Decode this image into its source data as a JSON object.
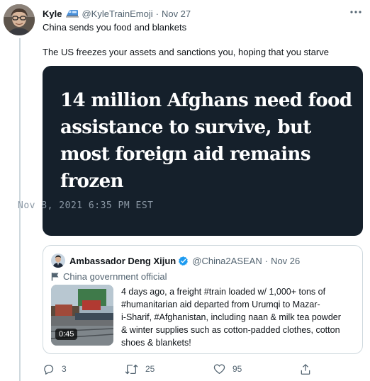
{
  "tweet": {
    "author_name": "Kyle",
    "author_emoji": "train-emoji",
    "handle": "@KyleTrainEmoji",
    "separator": "·",
    "date": "Nov 27",
    "text_lines": [
      "China sends you food and blankets",
      "The US freezes your assets and sanctions you, hoping that you starve"
    ],
    "media_card": {
      "headline_lines": [
        "14 million Afghans need food",
        "assistance to survive, but",
        "most foreign aid remains",
        "frozen"
      ],
      "dateline": "Nov 8, 2021 6:35 PM EST",
      "background": "#15202b"
    }
  },
  "quoted_tweet": {
    "author_name": "Ambassador Deng Xijun",
    "handle": "@China2ASEAN",
    "separator": "·",
    "date": "Nov 26",
    "label": "China government official",
    "thumbnail_duration": "0:45",
    "text_lines": [
      "4 days ago, a freight #train loaded w/ 1,000+ tons of",
      "#humanitarian aid departed from Urumqi to Mazar-",
      "i-Sharif, #Afghanistan, including naan & milk tea powder",
      "& winter supplies such as cotton-padded clothes, cotton",
      "shoes & blankets!"
    ]
  },
  "actions": {
    "reply_count": "3",
    "retweet_count": "25",
    "like_count": "95"
  },
  "colors": {
    "text": "#0f1419",
    "muted": "#536471",
    "border": "#cfd9de",
    "verified": "#1d9bf0"
  }
}
